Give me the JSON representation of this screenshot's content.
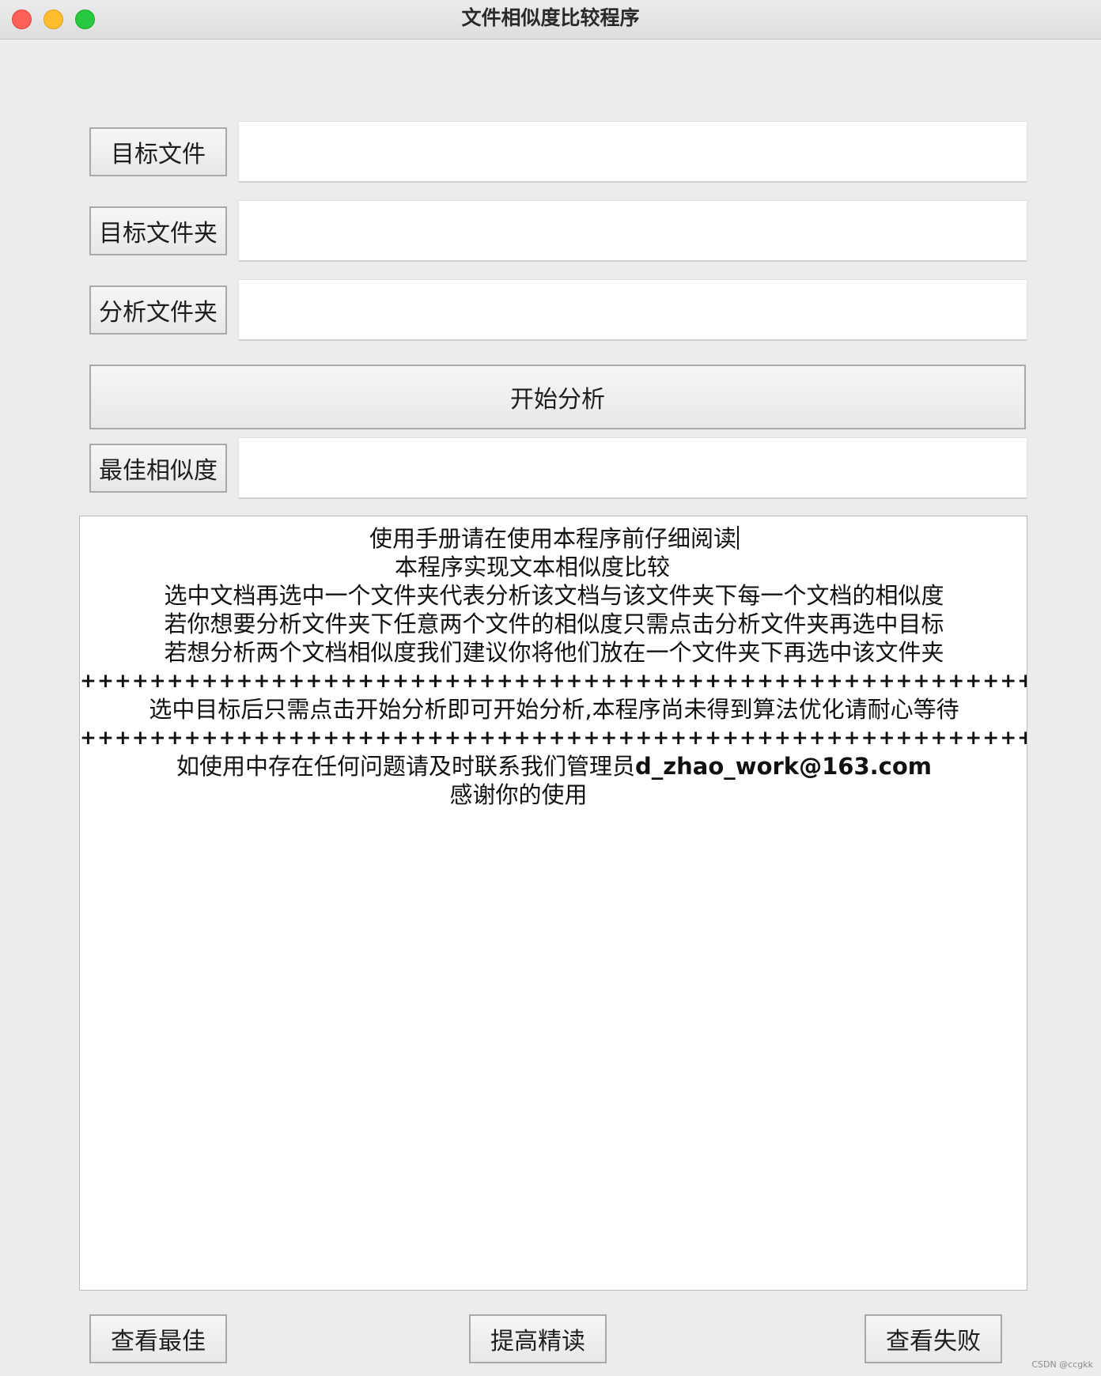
{
  "window": {
    "title": "文件相似度比较程序"
  },
  "form": {
    "target_file_label": "目标文件",
    "target_folder_label": "目标文件夹",
    "analysis_folder_label": "分析文件夹",
    "start_button": "开始分析",
    "best_similarity_label": "最佳相似度",
    "target_file_value": "",
    "target_folder_value": "",
    "analysis_folder_value": "",
    "best_similarity_value": ""
  },
  "manual": {
    "line1": "使用手册请在使用本程序前仔细阅读",
    "line2": "本程序实现文本相似度比较",
    "line3": "选中文档再选中一个文件夹代表分析该文档与该文件夹下每一个文档的相似度",
    "line4": "若你想要分析文件夹下任意两个文件的相似度只需点击分析文件夹再选中目标",
    "line5": "若想分析两个文档相似度我们建议你将他们放在一个文件夹下再选中该文件夹",
    "separator1": "+++++++++++++++++++++++++++++++++++++++++++++++++++++++++",
    "line6": "选中目标后只需点击开始分析即可开始分析,本程序尚未得到算法优化请耐心等待",
    "separator2": "+++++++++++++++++++++++++++++++++++++++++++++++++++++++++",
    "line7_prefix": "如使用中存在任何问题请及时联系我们管理员",
    "line7_email": "d_zhao_work@163.com",
    "line8": "感谢你的使用"
  },
  "footer": {
    "view_best_button": "查看最佳",
    "improve_button": "提高精读",
    "view_failed_button": "查看失败"
  },
  "watermark": "CSDN @ccgkk"
}
